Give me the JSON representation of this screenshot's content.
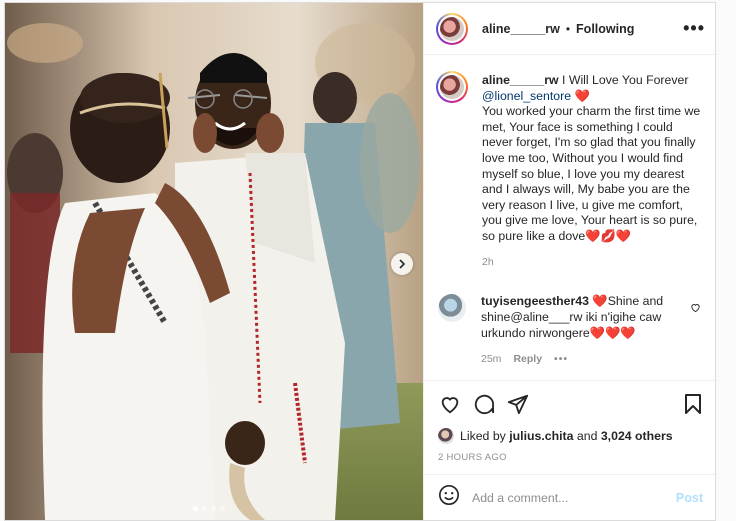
{
  "header": {
    "username": "aline_____rw",
    "separator": "•",
    "follow_status": "Following",
    "more_glyph": "•••"
  },
  "caption": {
    "username": "aline_____rw",
    "text_line1": "I Will Love You Forever",
    "mention": "@lionel_sentore",
    "heart": "❤️",
    "body": "You worked your charm the first time we met, Your face is something I could never forget, I'm so glad that you finally love me too, Without you I would find myself so blue, I love you my dearest and I always will, My babe you are the very reason I live, u give me comfort, you give me love, Your heart is so pure, so pure like a dove",
    "emojis": "❤️💋❤️",
    "time": "2h"
  },
  "comment": {
    "username": "tuyisengeesther43",
    "text": "❤️Shine and shine@aline___rw iki n'igihe caw urkundo nirwongere❤️❤️❤️",
    "time": "25m",
    "reply_label": "Reply",
    "more_glyph": "•••"
  },
  "likes": {
    "prefix": "Liked by",
    "user": "julius.chita",
    "middle": "and",
    "count": "3,024 others"
  },
  "timestamp": "2 HOURS AGO",
  "add_comment": {
    "placeholder": "Add a comment...",
    "post_label": "Post"
  },
  "carousel": {
    "slides": 4,
    "active_index": 0
  },
  "colors": {
    "link": "#00376b",
    "muted": "#8e8e8e",
    "post_disabled": "#b2dffc",
    "heart": "#ed4956"
  }
}
